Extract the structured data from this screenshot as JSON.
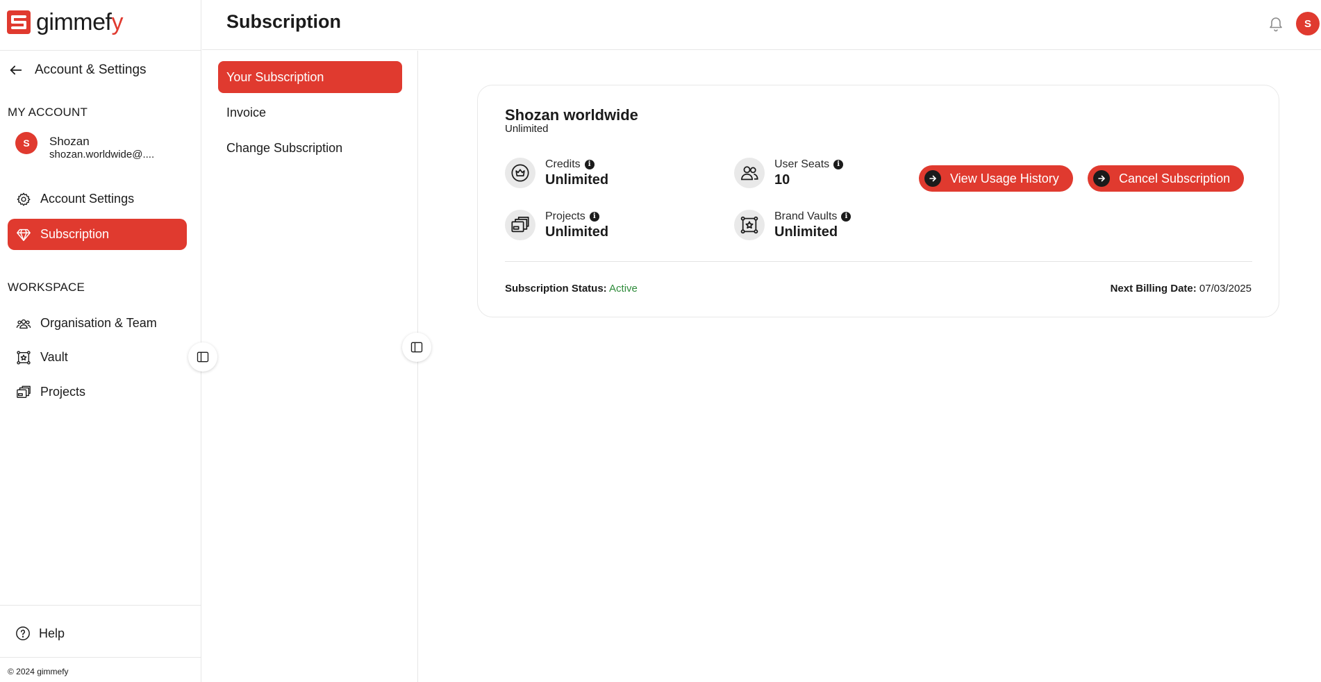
{
  "brand": {
    "name_main": "gimmef",
    "name_tail": "y",
    "accent": "#e03a2f"
  },
  "sidebar": {
    "back_label": "Account & Settings",
    "my_account_label": "MY ACCOUNT",
    "user": {
      "initial": "S",
      "name": "Shozan",
      "email": "shozan.worldwide@...."
    },
    "account_items": [
      {
        "label": "Account Settings",
        "icon": "gear-icon",
        "active": false
      },
      {
        "label": "Subscription",
        "icon": "diamond-icon",
        "active": true
      }
    ],
    "workspace_label": "WORKSPACE",
    "workspace_items": [
      {
        "label": "Organisation & Team",
        "icon": "team-icon"
      },
      {
        "label": "Vault",
        "icon": "vault-icon"
      },
      {
        "label": "Projects",
        "icon": "projects-icon"
      }
    ],
    "help_label": "Help",
    "copyright": "© 2024 gimmefy"
  },
  "header": {
    "title": "Subscription",
    "avatar_initial": "S"
  },
  "subnav": {
    "items": [
      {
        "label": "Your Subscription",
        "active": true
      },
      {
        "label": "Invoice",
        "active": false
      },
      {
        "label": "Change Subscription",
        "active": false
      }
    ]
  },
  "subscription": {
    "plan_name": "Shozan worldwide",
    "plan_tier": "Unlimited",
    "stats": {
      "credits": {
        "label": "Credits",
        "value": "Unlimited"
      },
      "user_seats": {
        "label": "User Seats",
        "value": "10"
      },
      "projects": {
        "label": "Projects",
        "value": "Unlimited"
      },
      "brand_vaults": {
        "label": "Brand Vaults",
        "value": "Unlimited"
      }
    },
    "view_usage_label": "View Usage History",
    "cancel_label": "Cancel Subscription",
    "status_label": "Subscription Status:",
    "status_value": "Active",
    "billing_label": "Next Billing Date:",
    "billing_value": "07/03/2025"
  }
}
